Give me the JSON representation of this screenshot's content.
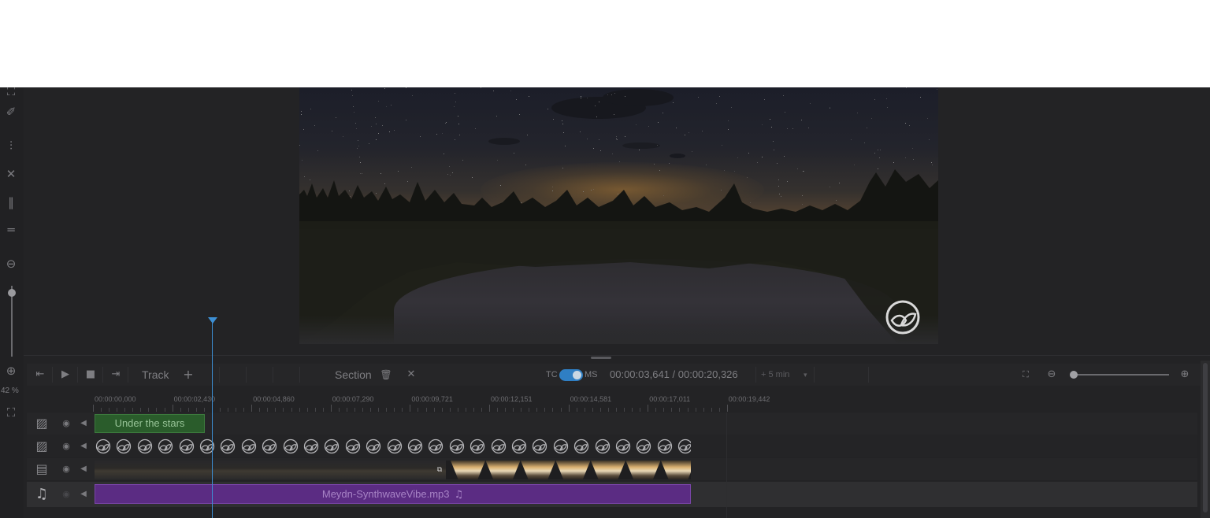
{
  "app": {
    "zoom_percent": "42 %",
    "preview": {
      "logo_icon": "leaf-logo"
    },
    "toolbar": {
      "track_label": "Track",
      "add_track_icon": "+",
      "section_label": "Section",
      "tc_label": "TC",
      "ms_label": "MS",
      "timecode": "00:00:03,641 / 00:00:20,326",
      "duration_dropdown": "+ 5 min",
      "dropdown_arrow": "▾",
      "icons": {
        "to_start": "⇤",
        "play": "▶",
        "stop": "■",
        "to_end": "⇥",
        "delete": "🗑",
        "close": "✕",
        "fit": "⛶",
        "zoom_out": "⊖",
        "zoom_in": "⊕"
      }
    },
    "left_tools": {
      "items": [
        "⛶",
        "✐",
        "⫶",
        "✕",
        "‖",
        "═",
        "⊖",
        "⊕",
        "⛶"
      ]
    },
    "ruler": {
      "ticks": [
        "00:00:00,000",
        "00:00:02,430",
        "00:00:04,860",
        "00:00:07,290",
        "00:00:09,721",
        "00:00:12,151",
        "00:00:14,581",
        "00:00:17,011",
        "00:00:19,442"
      ]
    },
    "tracks": [
      {
        "type_icon": "image-icon",
        "glyph": "▨",
        "eye": "◉",
        "mute": "◀",
        "clip_label": "Under the stars"
      },
      {
        "type_icon": "image-icon",
        "glyph": "▨",
        "eye": "◉",
        "mute": "◀"
      },
      {
        "type_icon": "film-icon",
        "glyph": "▤",
        "eye": "◉",
        "mute": "◀"
      },
      {
        "type_icon": "music-icon",
        "glyph": "♫",
        "eye": "◉",
        "mute": "◀",
        "clip_label": "Meydn-SynthwaveVibe.mp3",
        "clip_icon": "♫"
      }
    ],
    "playhead_time": "00:00:03,641",
    "colors": {
      "accent": "#3d8fd4",
      "title_clip": "#2a5c2b",
      "audio_clip": "#5b2c83"
    }
  }
}
